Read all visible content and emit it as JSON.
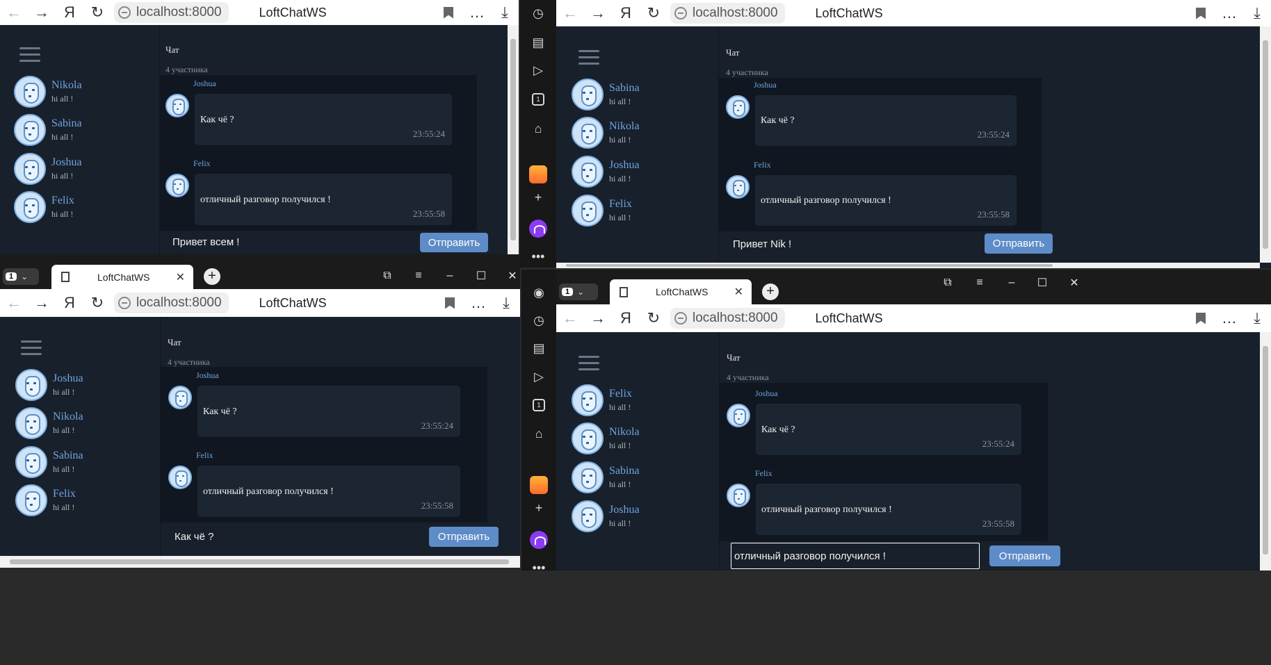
{
  "browser": {
    "address": "localhost:8000",
    "page_title": "LoftChatWS",
    "tab_title": "LoftChatWS",
    "tab_count": "1",
    "new_tab_symbol": "+",
    "close_tab_symbol": "✕"
  },
  "chat": {
    "title": "Чат",
    "members": "4 участника",
    "send_label": "Отправить",
    "messages": [
      {
        "author": "Joshua",
        "text": "Как чё ?",
        "time": "23:55:24"
      },
      {
        "author": "Felix",
        "text": "отличный разговор получился !",
        "time": "23:55:58"
      }
    ]
  },
  "windows": [
    {
      "users": [
        {
          "name": "Nikola",
          "status": "hi all !"
        },
        {
          "name": "Sabina",
          "status": "hi all !"
        },
        {
          "name": "Joshua",
          "status": "hi all !"
        },
        {
          "name": "Felix",
          "status": "hi all !"
        }
      ],
      "input": "Привет всем !"
    },
    {
      "users": [
        {
          "name": "Sabina",
          "status": "hi all !"
        },
        {
          "name": "Nikola",
          "status": "hi all !"
        },
        {
          "name": "Joshua",
          "status": "hi all !"
        },
        {
          "name": "Felix",
          "status": "hi all !"
        }
      ],
      "input": "Привет Nik !"
    },
    {
      "users": [
        {
          "name": "Joshua",
          "status": "hi all !"
        },
        {
          "name": "Nikola",
          "status": "hi all !"
        },
        {
          "name": "Sabina",
          "status": "hi all !"
        },
        {
          "name": "Felix",
          "status": "hi all !"
        }
      ],
      "input": "Как чё ?"
    },
    {
      "users": [
        {
          "name": "Felix",
          "status": "hi all !"
        },
        {
          "name": "Nikola",
          "status": "hi all !"
        },
        {
          "name": "Sabina",
          "status": "hi all !"
        },
        {
          "name": "Joshua",
          "status": "hi all !"
        }
      ],
      "input": "отличный разговор получился !"
    }
  ],
  "icons": {
    "back": "back-arrow-icon",
    "forward": "forward-arrow-icon",
    "yandex": "yandex-icon",
    "reload": "reload-icon",
    "bookmark": "bookmark-icon",
    "menu": "more-icon",
    "download": "download-icon"
  },
  "colors": {
    "page_bg": "#18202b",
    "messages_bg": "#101720",
    "bubble_bg": "#1c2633",
    "accent": "#6fa5e0",
    "send_button": "#5e8cc8"
  }
}
